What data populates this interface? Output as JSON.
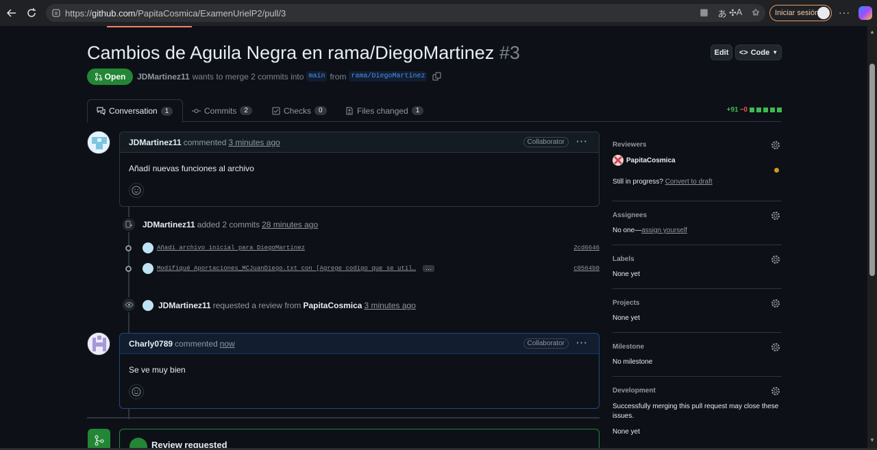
{
  "browser": {
    "url_prefix": "https://",
    "url_domain": "github.com",
    "url_path": "/PapitaCosmica/ExamenUrielP2/pull/3",
    "signin_label": "Iniciar sesión"
  },
  "pr": {
    "title": "Cambios de Aguila Negra en rama/DiegoMartinez",
    "number": "#3",
    "edit_label": "Edit",
    "code_label": "Code",
    "state": "Open",
    "author": "JDMartinez11",
    "merge_text": "wants to merge 2 commits into",
    "base_branch": "main",
    "from_text": "from",
    "head_branch": "rama/DiegoMartinez"
  },
  "tabs": [
    {
      "label": "Conversation",
      "count": "1"
    },
    {
      "label": "Commits",
      "count": "2"
    },
    {
      "label": "Checks",
      "count": "0"
    },
    {
      "label": "Files changed",
      "count": "1"
    }
  ],
  "diffstat": {
    "additions": "+91",
    "deletions": "−0"
  },
  "comments": [
    {
      "author": "JDMartinez11",
      "action": "commented",
      "time": "3 minutes ago",
      "badge": "Collaborator",
      "body": "Añadí nuevas funciones al archivo"
    },
    {
      "author": "Charly0789",
      "action": "commented",
      "time": "now",
      "badge": "Collaborator",
      "body": "Se ve muy bien"
    }
  ],
  "commits_event": {
    "author": "JDMartinez11",
    "action": "added 2 commits",
    "time": "28 minutes ago"
  },
  "commits": [
    {
      "message": "Añadí archivo inicial para DiegoMartinez",
      "sha": "2cd6646"
    },
    {
      "message": "Modifiqué Aportaciones_MCJuanDiego.txt con [Agrege codigo que se util…",
      "sha": "c0564b0",
      "ellipsis": "…"
    }
  ],
  "review_event": {
    "author": "JDMartinez11",
    "action": "requested a review from",
    "reviewer": "PapitaCosmica",
    "time": "3 minutes ago"
  },
  "sidebar": {
    "reviewers": {
      "heading": "Reviewers",
      "name": "PapitaCosmica",
      "progress_text": "Still in progress?",
      "progress_link": "Convert to draft",
      "status_color": "#d29922"
    },
    "assignees": {
      "heading": "Assignees",
      "value": "No one—",
      "link": "assign yourself"
    },
    "labels": {
      "heading": "Labels",
      "value": "None yet"
    },
    "projects": {
      "heading": "Projects",
      "value": "None yet"
    },
    "milestone": {
      "heading": "Milestone",
      "value": "No milestone"
    },
    "development": {
      "heading": "Development",
      "text": "Successfully merging this pull request may close these issues.",
      "value": "None yet"
    }
  },
  "merge": {
    "title": "Review requested"
  },
  "colors": {
    "open_green": "#238636",
    "link_blue": "#4493f8",
    "background": "#0d1117"
  }
}
